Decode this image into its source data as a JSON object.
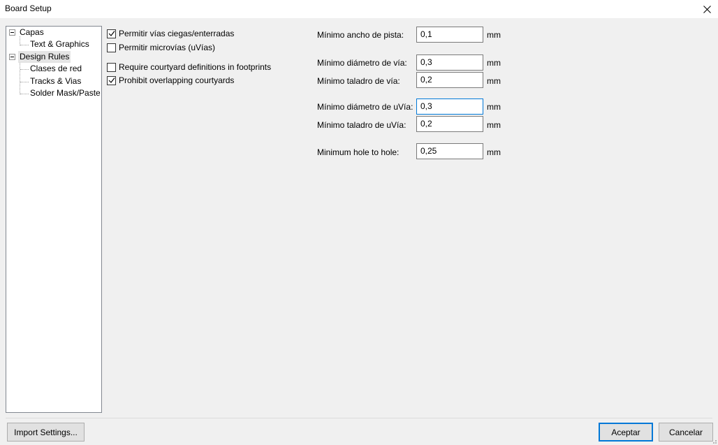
{
  "window": {
    "title": "Board Setup"
  },
  "tree": {
    "items": [
      {
        "label": "Capas",
        "level": 0,
        "expanded": true
      },
      {
        "label": "Text & Graphics",
        "level": 1
      },
      {
        "label": "Design Rules",
        "level": 0,
        "expanded": true,
        "selected": true
      },
      {
        "label": "Clases de red",
        "level": 1
      },
      {
        "label": "Tracks & Vias",
        "level": 1
      },
      {
        "label": "Solder Mask/Paste",
        "level": 1
      }
    ]
  },
  "checkboxes": [
    {
      "label": "Permitir vías ciegas/enterradas",
      "checked": true
    },
    {
      "label": "Permitir microvías (uVías)",
      "checked": false
    },
    {
      "label": "Require courtyard definitions in footprints",
      "checked": false
    },
    {
      "label": "Prohibit overlapping courtyards",
      "checked": true
    }
  ],
  "fields": [
    {
      "label": "Mínimo ancho de pista:",
      "value": "0,1",
      "unit": "mm"
    },
    {
      "label": "Mínimo diámetro de vía:",
      "value": "0,3",
      "unit": "mm"
    },
    {
      "label": "Mínimo taladro de vía:",
      "value": "0,2",
      "unit": "mm"
    },
    {
      "label": "Mínimo diámetro de uVía:",
      "value": "0,3",
      "unit": "mm",
      "focused": true
    },
    {
      "label": "Mínimo taladro de uVía:",
      "value": "0,2",
      "unit": "mm"
    },
    {
      "label": "Minimum hole to hole:",
      "value": "0,25",
      "unit": "mm"
    }
  ],
  "buttons": {
    "import": "Import Settings...",
    "ok": "Aceptar",
    "cancel": "Cancelar"
  },
  "icons": {
    "close": "close-icon",
    "check": "checkmark-icon",
    "expander": "minus-expander-icon",
    "grip": "resize-grip-icon"
  },
  "colors": {
    "accent": "#0078d7",
    "background": "#f0f0f0"
  }
}
